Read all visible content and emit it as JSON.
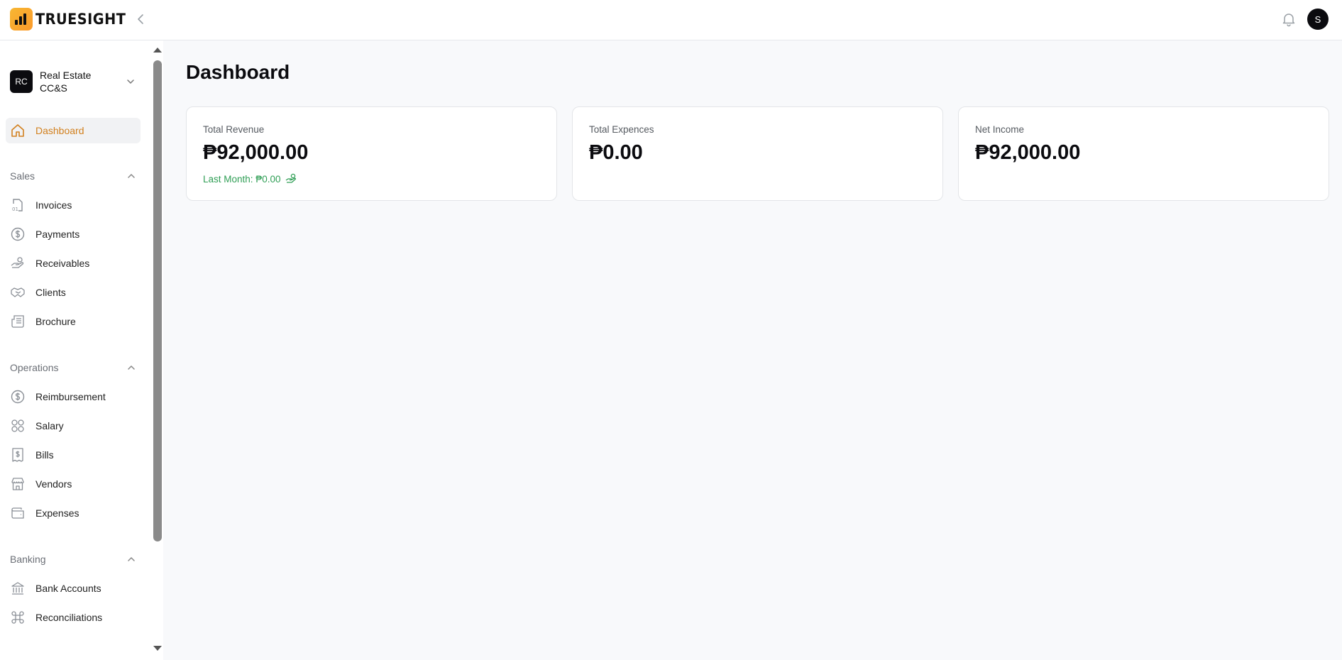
{
  "app": {
    "brand": "TRUESIGHT",
    "avatar_initial": "S"
  },
  "org": {
    "initials": "RC",
    "name": "Real Estate CC&S"
  },
  "sidebar": {
    "dashboard": {
      "label": "Dashboard",
      "icon": "home-icon"
    },
    "sections": [
      {
        "title": "Sales",
        "items": [
          {
            "label": "Invoices",
            "icon": "invoice-icon"
          },
          {
            "label": "Payments",
            "icon": "dollar-circle-icon"
          },
          {
            "label": "Receivables",
            "icon": "hand-coins-icon"
          },
          {
            "label": "Clients",
            "icon": "handshake-icon"
          },
          {
            "label": "Brochure",
            "icon": "newspaper-icon"
          }
        ]
      },
      {
        "title": "Operations",
        "items": [
          {
            "label": "Reimbursement",
            "icon": "dollar-circle-icon"
          },
          {
            "label": "Salary",
            "icon": "grid-circles-icon"
          },
          {
            "label": "Bills",
            "icon": "receipt-icon"
          },
          {
            "label": "Vendors",
            "icon": "store-icon"
          },
          {
            "label": "Expenses",
            "icon": "wallet-icon"
          }
        ]
      },
      {
        "title": "Banking",
        "items": [
          {
            "label": "Bank Accounts",
            "icon": "bank-icon"
          },
          {
            "label": "Reconciliations",
            "icon": "command-icon"
          }
        ]
      }
    ]
  },
  "main": {
    "title": "Dashboard",
    "cards": [
      {
        "label": "Total Revenue",
        "value": "₱92,000.00",
        "sub": "Last Month: ₱0.00"
      },
      {
        "label": "Total Expences",
        "value": "₱0.00"
      },
      {
        "label": "Net Income",
        "value": "₱92,000.00"
      }
    ]
  },
  "colors": {
    "accent": "#d2801e",
    "positive": "#2f9e55",
    "brand_gradient_start": "#f7b733",
    "brand_gradient_end": "#fc9a2a"
  }
}
